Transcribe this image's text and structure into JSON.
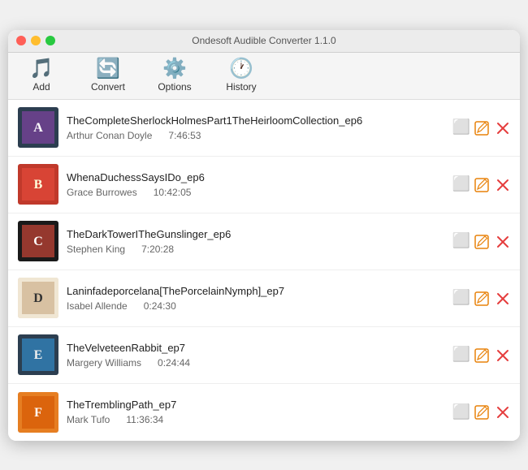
{
  "window": {
    "title": "Ondesoft Audible Converter 1.1.0"
  },
  "toolbar": {
    "items": [
      {
        "id": "add",
        "label": "Add",
        "icon": "♪",
        "icon_type": "orange"
      },
      {
        "id": "convert",
        "label": "Convert",
        "icon": "↺",
        "icon_type": "orange"
      },
      {
        "id": "options",
        "label": "Options",
        "icon": "⚙",
        "icon_type": "orange"
      },
      {
        "id": "history",
        "label": "History",
        "icon": "🕐",
        "icon_type": "orange"
      }
    ]
  },
  "books": [
    {
      "id": "book1",
      "title": "TheCompleteSherlockHolmesPart1TheHeirloomCollection_ep6",
      "author": "Arthur Conan Doyle",
      "duration": "7:46:53",
      "cover_color1": "#2c3e50",
      "cover_color2": "#8e44ad"
    },
    {
      "id": "book2",
      "title": "WhenaDuchessSaysIDo_ep6",
      "author": "Grace Burrowes",
      "duration": "10:42:05",
      "cover_color1": "#c0392b",
      "cover_color2": "#e74c3c"
    },
    {
      "id": "book3",
      "title": "TheDarkTowerITheGunslinger_ep6",
      "author": "Stephen King",
      "duration": "7:20:28",
      "cover_color1": "#1a1a1a",
      "cover_color2": "#e74c3c"
    },
    {
      "id": "book4",
      "title": "Laninfadeporcelana[ThePorcelainNymph]_ep7",
      "author": "Isabel Allende",
      "duration": "0:24:30",
      "cover_color1": "#f0e6d3",
      "cover_color2": "#c8a882"
    },
    {
      "id": "book5",
      "title": "TheVelveteenRabbit_ep7",
      "author": "Margery Williams",
      "duration": "0:24:44",
      "cover_color1": "#2c3e50",
      "cover_color2": "#3498db"
    },
    {
      "id": "book6",
      "title": "TheTremblingPath_ep7",
      "author": "Mark Tufo",
      "duration": "11:36:34",
      "cover_color1": "#e67e22",
      "cover_color2": "#d35400"
    }
  ]
}
